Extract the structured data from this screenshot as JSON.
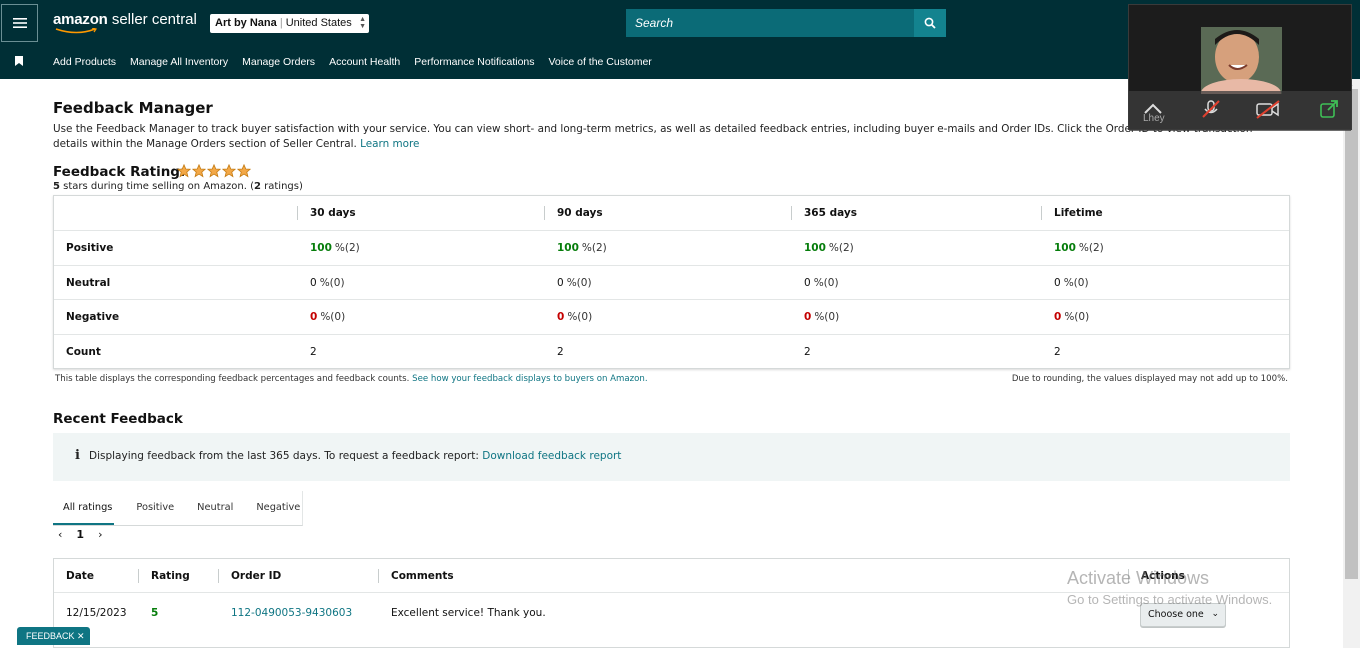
{
  "header": {
    "brand_amazon": "amazon",
    "brand_rest": " seller central",
    "store_name": "Art by Nana",
    "store_region": "United States",
    "search_placeholder": "Search"
  },
  "nav": {
    "items": [
      "Add Products",
      "Manage All Inventory",
      "Manage Orders",
      "Account Health",
      "Performance Notifications",
      "Voice of the Customer"
    ]
  },
  "page": {
    "title": "Feedback Manager",
    "intro": "Use the Feedback Manager to track buyer satisfaction with your service. You can view short- and long-term metrics, as well as detailed feedback entries, including buyer e-mails and Order IDs. Click the Order ID to view transaction details within the Manage Orders section of Seller Central.",
    "learn_more": "Learn more"
  },
  "rating": {
    "title": "Feedback Rating:",
    "stars": 5,
    "stars_value": "5",
    "sub_middle": " stars during time selling on Amazon. (",
    "count": "2",
    "sub_end": " ratings)"
  },
  "metrics": {
    "columns": [
      "30 days",
      "90 days",
      "365 days",
      "Lifetime"
    ],
    "rows": [
      {
        "label": "Positive",
        "values": [
          {
            "n": "100",
            "p": "%(2)"
          },
          {
            "n": "100",
            "p": "%(2)"
          },
          {
            "n": "100",
            "p": "%(2)"
          },
          {
            "n": "100",
            "p": "%(2)"
          }
        ]
      },
      {
        "label": "Neutral",
        "values": [
          {
            "n": "0",
            "p": "%(0)"
          },
          {
            "n": "0",
            "p": "%(0)"
          },
          {
            "n": "0",
            "p": "%(0)"
          },
          {
            "n": "0",
            "p": "%(0)"
          }
        ]
      },
      {
        "label": "Negative",
        "values": [
          {
            "n": "0",
            "p": "%(0)"
          },
          {
            "n": "0",
            "p": "%(0)"
          },
          {
            "n": "0",
            "p": "%(0)"
          },
          {
            "n": "0",
            "p": "%(0)"
          }
        ]
      },
      {
        "label": "Count",
        "values": [
          {
            "n": "2",
            "p": ""
          },
          {
            "n": "2",
            "p": ""
          },
          {
            "n": "2",
            "p": ""
          },
          {
            "n": "2",
            "p": ""
          }
        ]
      }
    ],
    "note_left": "This table displays the corresponding feedback percentages and feedback counts.",
    "note_link": "See how your feedback displays to buyers on Amazon.",
    "note_right": "Due to rounding, the values displayed may not add up to 100%."
  },
  "recent": {
    "title": "Recent Feedback",
    "info_text": "Displaying feedback from the last 365 days. To request a feedback report:",
    "info_link": "Download feedback report",
    "tabs": [
      "All ratings",
      "Positive",
      "Neutral",
      "Negative"
    ],
    "page": "1",
    "headers": [
      "Date",
      "Rating",
      "Order ID",
      "Comments",
      "Actions"
    ],
    "rows": [
      {
        "date": "12/15/2023",
        "rating": "5",
        "order_id": "112-0490053-9430603",
        "comment": "Excellent service! Thank you.",
        "action": "Choose one"
      }
    ]
  },
  "feedback_tab": "FEEDBACK ✕",
  "watermark": {
    "line1": "Activate Windows",
    "line2": "Go to Settings to activate Windows."
  },
  "video": {
    "name": "Lhey"
  },
  "colors": {
    "header": "#002f36",
    "search": "#0b6b77",
    "link": "#0f7583",
    "positive": "#067d0b",
    "negative": "#c40000",
    "star": "#f3a847"
  }
}
